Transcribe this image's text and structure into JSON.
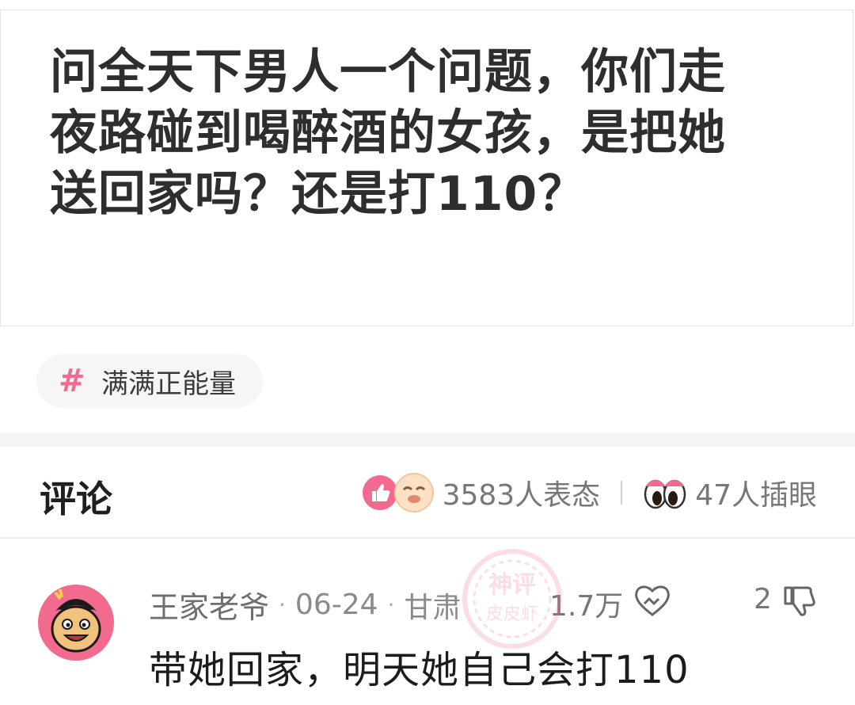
{
  "post": {
    "lines": [
      "问全天下男人一个问题，你们走",
      "夜路碰到喝醉酒的女孩，是把她",
      "送回家吗？还是打110？"
    ]
  },
  "topic_tag": {
    "icon": "hash-icon",
    "label": "满满正能量"
  },
  "comments_header": {
    "title": "评论",
    "reactions_count": "3583人表态",
    "views_count": "47人插眼"
  },
  "comment": {
    "user": "王家老爷",
    "date": "06-24",
    "location": "甘肃",
    "likes": "1.7万",
    "dislikes": "2",
    "text": "带她回家，明天她自己会打110",
    "stamp": "神评 皮皮虾"
  },
  "colors": {
    "accent_pink": "#f26a8d",
    "text_dark": "#2e2e2e",
    "muted": "#8a8a8a"
  }
}
